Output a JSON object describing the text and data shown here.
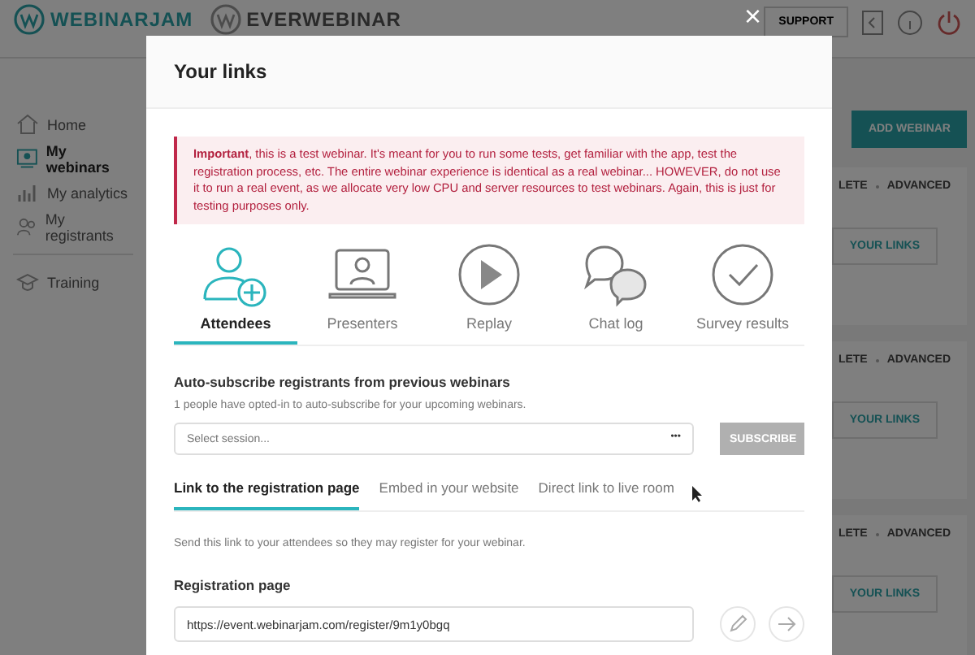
{
  "header": {
    "logos": [
      "WEBINARJAM",
      "EVERWEBINAR"
    ],
    "support_button": "SUPPORT"
  },
  "sidebar": {
    "items": [
      {
        "label": "Home",
        "kind": "home",
        "selected": false
      },
      {
        "label": "My webinars",
        "kind": "webinars",
        "selected": true
      },
      {
        "label": "My analytics",
        "kind": "analytics",
        "selected": false
      },
      {
        "label": "My registrants",
        "kind": "registrants",
        "selected": false
      },
      {
        "label": "Training",
        "kind": "training",
        "selected": false
      }
    ]
  },
  "add_button": "ADD WEBINAR",
  "webinar_cards": [
    {
      "actions": [
        "LETE",
        "ADVANCED"
      ],
      "links_button": "YOUR LINKS"
    },
    {
      "actions": [
        "LETE",
        "ADVANCED"
      ],
      "links_button": "YOUR LINKS"
    },
    {
      "actions": [
        "LETE",
        "ADVANCED"
      ],
      "links_button": "YOUR LINKS"
    }
  ],
  "modal": {
    "title": "Your links",
    "close": "×",
    "alert": "**Important**, this is a test webinar. It's meant for you to run some tests, get familiar with the app, test the registration process, etc. The entire webinar experience is identical as a real webinar... HOWEVER, do not use it to run a real event, as we allocate very low CPU and server resources to test webinars. Again, this is just for testing purposes only.",
    "tabs": [
      {
        "label": "Attendees",
        "kind": "attendees",
        "selected": true
      },
      {
        "label": "Presenters",
        "kind": "presenters",
        "selected": false
      },
      {
        "label": "Replay",
        "kind": "replay",
        "selected": false
      },
      {
        "label": "Chat log",
        "kind": "chat",
        "selected": false
      },
      {
        "label": "Survey results",
        "kind": "survey",
        "selected": false
      }
    ],
    "auto_subscribe": {
      "title": "Auto-subscribe registrants from previous webinars",
      "note": "1 people have opted-in to auto-subscribe for your upcoming webinars.",
      "select": {
        "placeholder": "Select session...",
        "menu": "•••"
      },
      "button": {
        "label": "SUBSCRIBE",
        "disabled": true
      }
    },
    "link_tabs": [
      {
        "label": "Link to the registration page",
        "selected": true
      },
      {
        "label": "Embed in your website",
        "selected": false
      },
      {
        "label": "Direct link to live room",
        "selected": false
      }
    ],
    "instructions": "Send this link to your attendees so they may register for your webinar.",
    "registration": {
      "label": "Registration page",
      "url": "https://event.webinarjam.com/register/9m1y0bgq"
    }
  }
}
